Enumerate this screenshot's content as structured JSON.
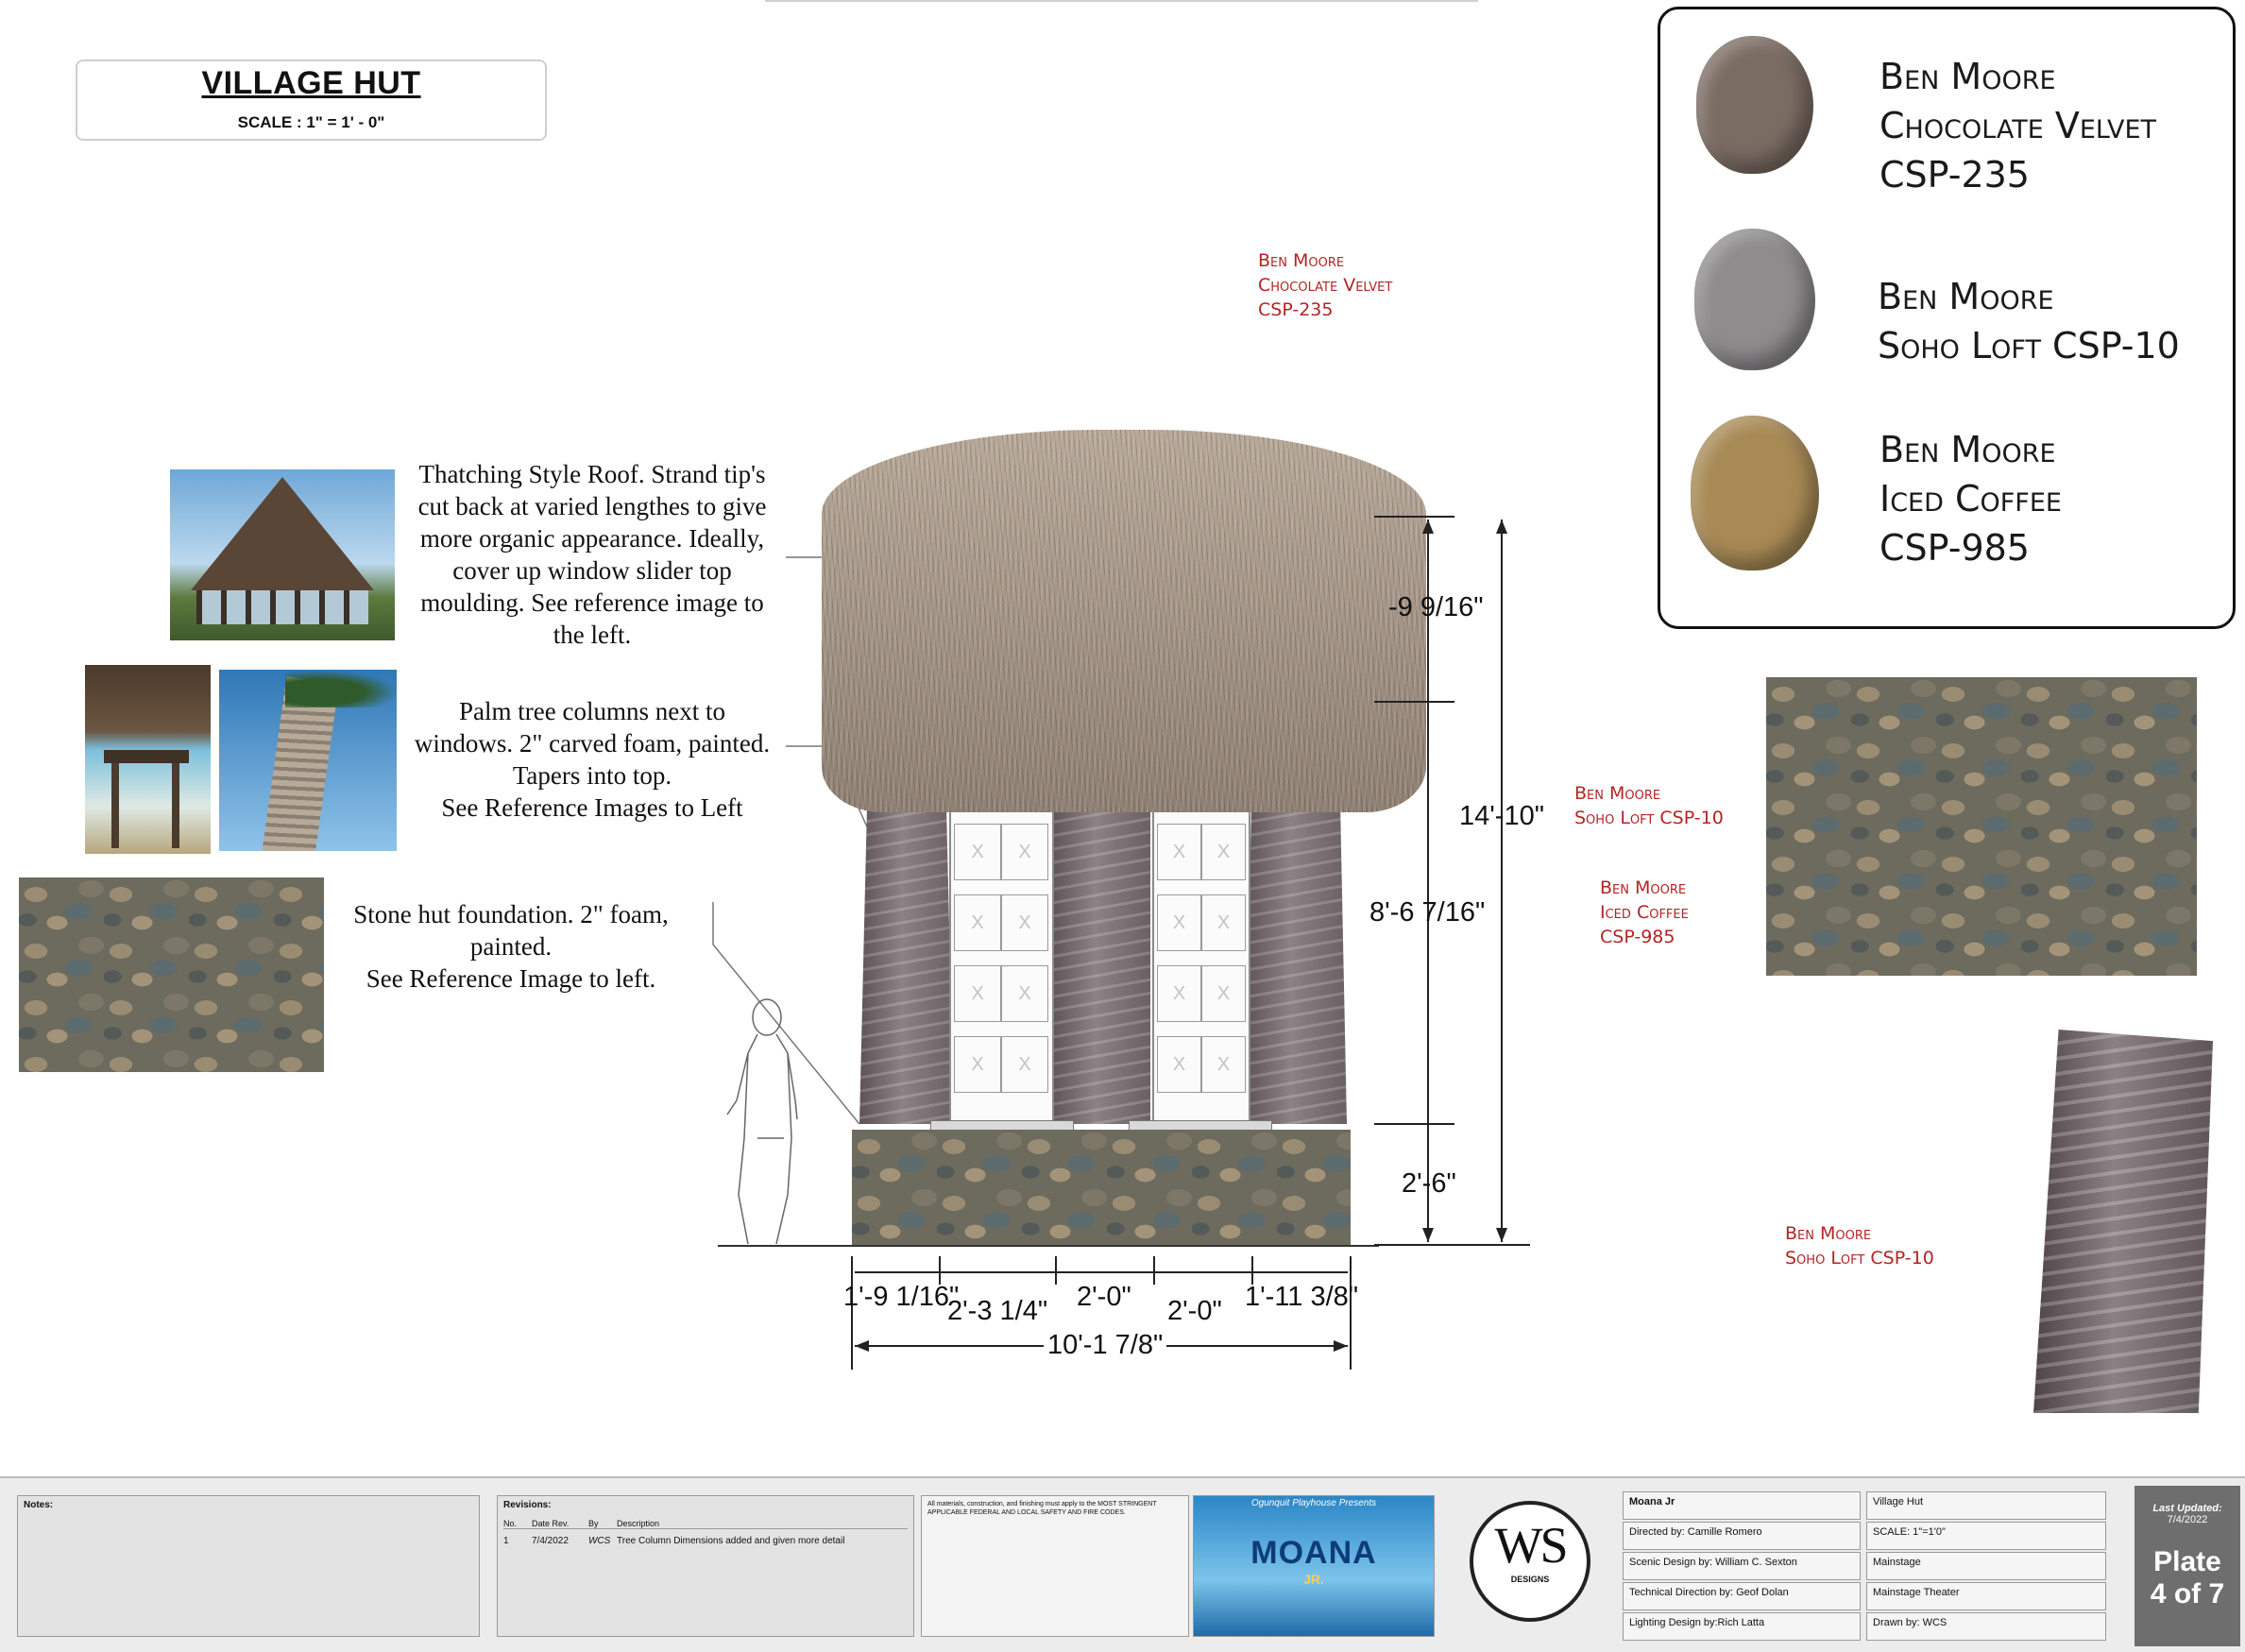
{
  "title": {
    "main": "VILLAGE HUT",
    "scale": "SCALE : 1\" = 1' - 0\""
  },
  "legend": {
    "items": [
      {
        "line1": "Ben Moore",
        "line2": "Chocolate Velvet",
        "line3": "CSP-235",
        "color": "#7b6c63"
      },
      {
        "line1": "Ben Moore",
        "line2": "Soho Loft CSP-10",
        "line3": "",
        "color": "#8f8c8e"
      },
      {
        "line1": "Ben Moore",
        "line2": "Iced Coffee",
        "line3": "CSP-985",
        "color": "#a88a55"
      }
    ]
  },
  "callouts": {
    "roof_paint": [
      "Ben Moore",
      "Chocolate Velvet",
      "CSP-235"
    ],
    "column_paint": [
      "Ben Moore",
      "Soho Loft CSP-10"
    ],
    "stone_paint": [
      "Ben Moore",
      "Iced Coffee",
      "CSP-985"
    ],
    "trunk_paint": [
      "Ben Moore",
      "Soho Loft CSP-10"
    ]
  },
  "notes": {
    "roof": [
      "Thatching Style Roof. Strand tip's",
      "cut back at varied lengthes to give",
      "more organic appearance. Ideally,",
      "cover up window slider top",
      "moulding. See reference image to",
      "the left."
    ],
    "columns": [
      "Palm tree columns next to",
      "windows. 2\" carved foam, painted.",
      "Tapers into top.",
      "See Reference Images to Left"
    ],
    "foundation": [
      "Stone hut foundation. 2\" foam,",
      "painted.",
      "See Reference Image to left."
    ]
  },
  "dimensions": {
    "roof_height": "-9 9/16\"",
    "total_height": "14'-10\"",
    "wall_height": "8'-6 7/16\"",
    "base_height": "2'-6\"",
    "widths": [
      "1'-9 1/16\"",
      "2'-3 1/4\"",
      "2'-0\"",
      "2'-0\"",
      "1'-11 3/8\""
    ],
    "total_width": "10'-1 7/8\""
  },
  "title_block": {
    "notes_label": "Notes:",
    "revisions_label": "Revisions:",
    "rev_headers": [
      "No.",
      "Date Rev.",
      "By",
      "Description"
    ],
    "rev_row": [
      "1",
      "7/4/2022",
      "WCS",
      "Tree Column Dimensions added and given more detail"
    ],
    "disclaimer": "All materials, construction, and finishing must apply to the MOST STRINGENT APPLICABLE FEDERAL AND LOCAL SAFETY AND FIRE CODES.",
    "show_presenter": "Ogunquit Playhouse Presents",
    "show_title": "MOANA",
    "show_sub": "JR.",
    "logo_text": "WS",
    "logo_sub": "DESIGNS",
    "fields_left": [
      "Moana Jr",
      "Directed by: Camille Romero",
      "Scenic Design by: William C. Sexton",
      "Technical Direction by: Geof Dolan",
      "Lighting Design by:Rich Latta"
    ],
    "fields_right": [
      "Village Hut",
      "SCALE: 1\"=1'0\"",
      "Mainstage",
      "Mainstage Theater",
      "Drawn by: WCS"
    ],
    "last_updated_label": "Last Updated:",
    "last_updated": "7/4/2022",
    "plate_line1": "Plate",
    "plate_line2": "4 of 7"
  }
}
